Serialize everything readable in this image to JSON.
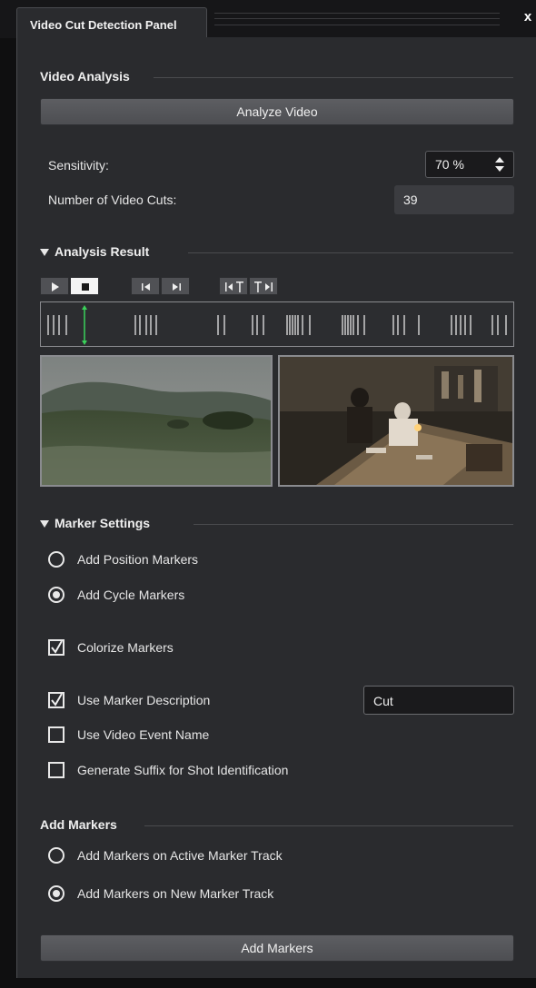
{
  "window": {
    "tab_title": "Video Cut Detection Panel",
    "close_label": "x"
  },
  "video_analysis": {
    "title": "Video Analysis",
    "analyze_button": "Analyze Video",
    "sensitivity_label": "Sensitivity:",
    "sensitivity_value": "70 %",
    "cuts_label": "Number of Video Cuts:",
    "cuts_value": "39"
  },
  "analysis_result": {
    "title": "Analysis Result",
    "transport": [
      {
        "name": "play-button",
        "icon": "play-icon"
      },
      {
        "name": "stop-button",
        "icon": "stop-icon",
        "active": true
      },
      {
        "name": "previous-cut-button",
        "icon": "skip-back-icon"
      },
      {
        "name": "next-cut-button",
        "icon": "skip-forward-icon"
      },
      {
        "name": "previous-marker-button",
        "icon": "marker-back-icon"
      },
      {
        "name": "next-marker-button",
        "icon": "marker-forward-icon"
      }
    ],
    "thumbnails": [
      {
        "name": "cut-thumbnail-left",
        "description": "landscape-hills"
      },
      {
        "name": "cut-thumbnail-right",
        "description": "interior-table-scene"
      }
    ],
    "playhead_color": "#3ad15a"
  },
  "marker_settings": {
    "title": "Marker Settings",
    "radio_position": "Add Position Markers",
    "radio_cycle": "Add Cycle Markers",
    "selected": "cycle",
    "colorize_label": "Colorize Markers",
    "colorize_checked": true,
    "use_description_label": "Use Marker Description",
    "use_description_checked": true,
    "description_value": "Cut",
    "use_event_name_label": "Use Video Event Name",
    "use_event_name_checked": false,
    "suffix_label": "Generate Suffix for Shot Identification",
    "suffix_checked": false
  },
  "add_markers": {
    "title": "Add Markers",
    "radio_active": "Add Markers on Active Marker Track",
    "radio_new": "Add Markers on New Marker Track",
    "selected": "new",
    "button_label": "Add Markers"
  }
}
